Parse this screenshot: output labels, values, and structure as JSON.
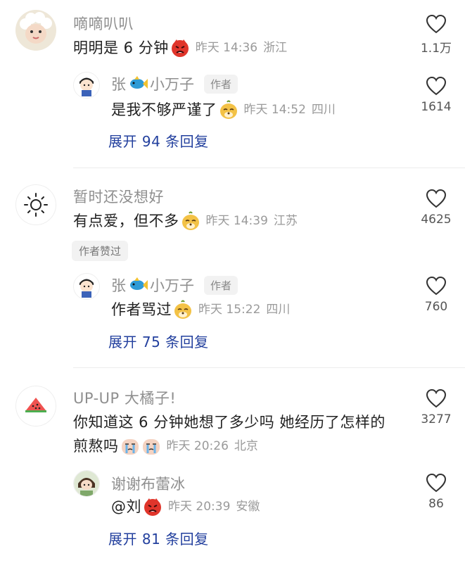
{
  "comments": [
    {
      "username": "嘀嘀叭叭",
      "text": "明明是 6 分钟",
      "time": "昨天 14:36",
      "location": "浙江",
      "likes": "1.1万",
      "reply": {
        "name_part1": "张",
        "name_part2": "小万子",
        "author_tag": "作者",
        "text": "是我不够严谨了",
        "time": "昨天 14:52",
        "location": "四川",
        "likes": "1614"
      },
      "expand": "展开 94 条回复"
    },
    {
      "username": "暂时还没想好",
      "text": "有点爱，但不多",
      "time": "昨天 14:39",
      "location": "江苏",
      "likes": "4625",
      "liked_tag": "作者赞过",
      "reply": {
        "name_part1": "张",
        "name_part2": "小万子",
        "author_tag": "作者",
        "text": "作者骂过",
        "time": "昨天 15:22",
        "location": "四川",
        "likes": "760"
      },
      "expand": "展开 75 条回复"
    },
    {
      "username": "UP-UP 大橘子!",
      "text_line1": "你知道这 6 分钟她想了多少吗  她经历了怎样的",
      "text_line2": "煎熬吗",
      "time": "昨天 20:26",
      "location": "北京",
      "likes": "3277",
      "reply": {
        "name": "谢谢布蕾冰",
        "text": "@刘",
        "time": "昨天 20:39",
        "location": "安徽",
        "likes": "86"
      },
      "expand": "展开 81 条回复"
    }
  ],
  "icons": {
    "like": "heart-outline-icon",
    "angry_emoji": "angry-face-emoji",
    "doge_emoji": "dog-face-emoji",
    "crying_emoji": "crying-face-emoji",
    "fish": "fish-icon",
    "sun": "sun-icon",
    "watermelon": "watermelon-icon",
    "sheep": "sheep-avatar"
  },
  "colors": {
    "expand_link": "#23409e",
    "meta_gray": "#9a9a9a",
    "name_gray": "#8f8f8f"
  }
}
